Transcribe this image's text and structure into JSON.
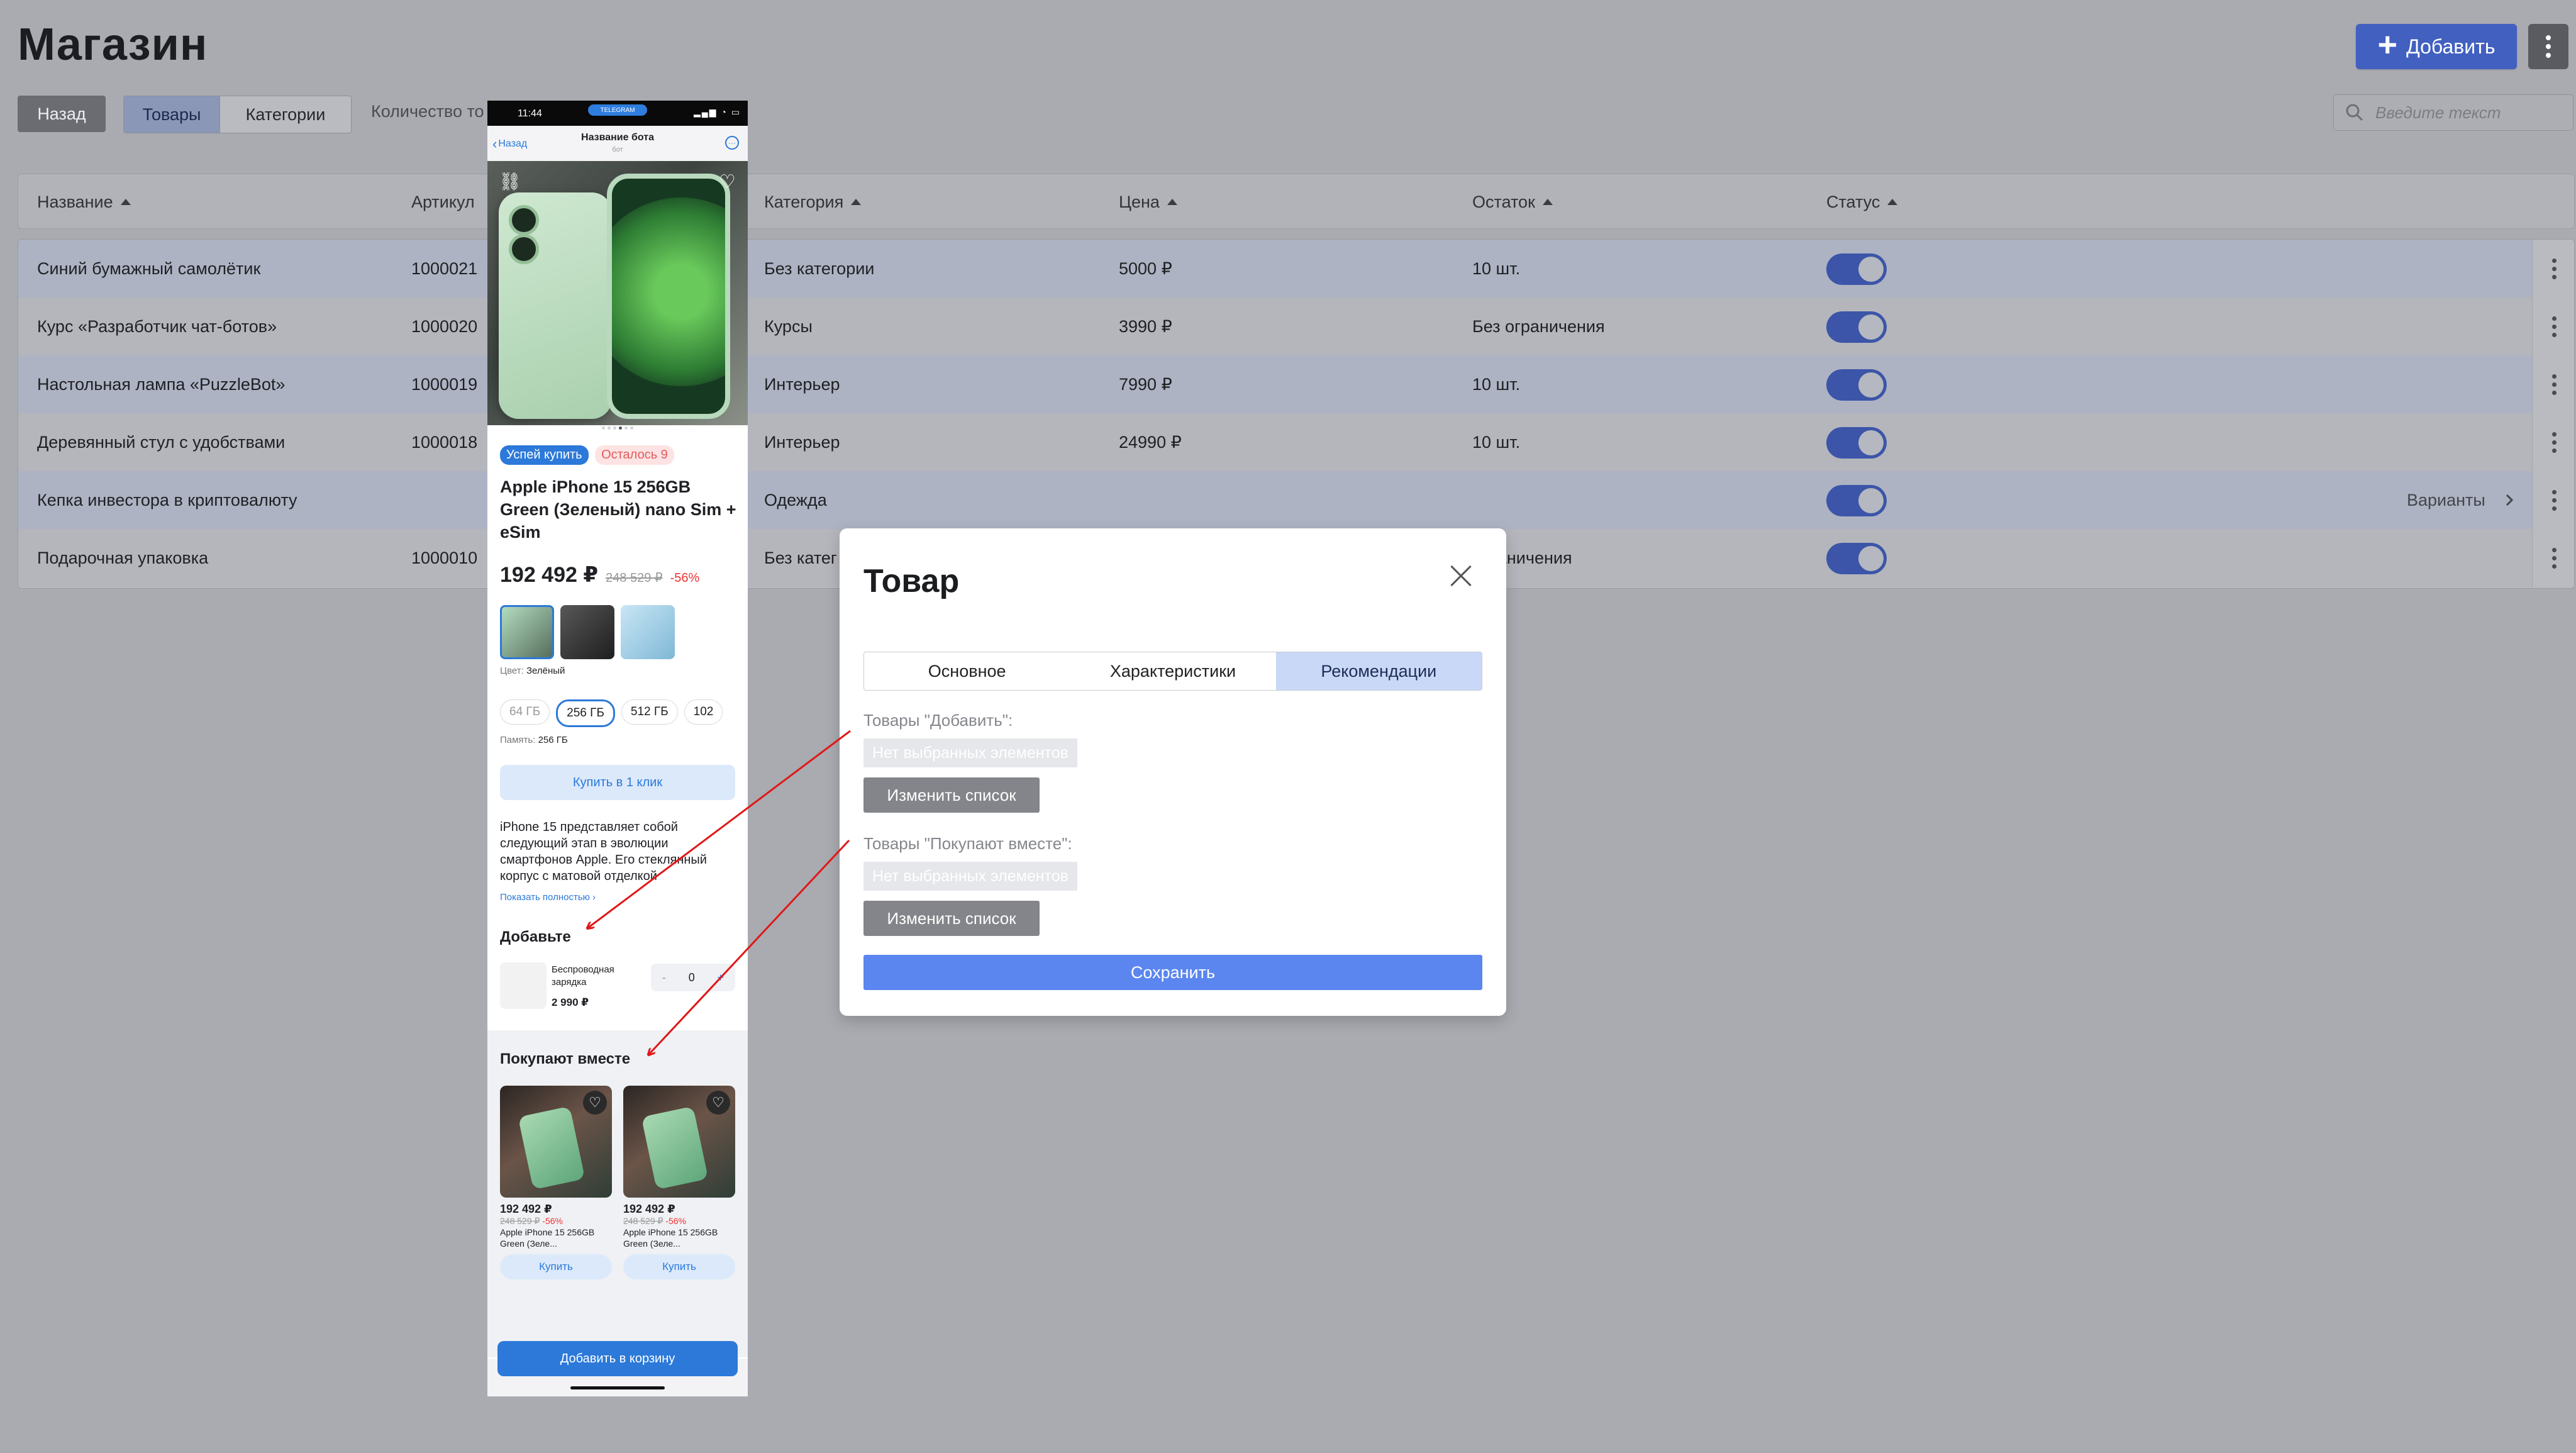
{
  "header": {
    "title": "Магазин",
    "add_label": "Добавить"
  },
  "toolbar": {
    "back_label": "Назад",
    "tabs": [
      "Товары",
      "Категории"
    ],
    "count_label": "Количество то",
    "search_placeholder": "Введите текст"
  },
  "table": {
    "columns": [
      "Название",
      "Артикул",
      "Категория",
      "Цена",
      "Остаток",
      "Статус"
    ],
    "rows": [
      {
        "name": "Синий бумажный самолётик",
        "sku": "1000021",
        "category": "Без категории",
        "price": "5000 ₽",
        "stock": "10 шт."
      },
      {
        "name": "Курс «Разработчик чат-ботов»",
        "sku": "1000020",
        "category": "Курсы",
        "price": "3990 ₽",
        "stock": "Без ограничения"
      },
      {
        "name": "Настольная лампа «PuzzleBot»",
        "sku": "1000019",
        "category": "Интерьер",
        "price": "7990 ₽",
        "stock": "10 шт."
      },
      {
        "name": "Деревянный стул с удобствами",
        "sku": "1000018",
        "category": "Интерьер",
        "price": "24990 ₽",
        "stock": "10 шт."
      },
      {
        "name": "Кепка инвестора в криптовалюту",
        "sku": "",
        "category": "Одежда",
        "price": "",
        "stock": "",
        "variants": "Варианты"
      },
      {
        "name": "Подарочная упаковка",
        "sku": "1000010",
        "category": "Без катег",
        "price": "",
        "stock": "ограничения"
      }
    ]
  },
  "phone": {
    "time": "11:44",
    "telegram": "TELEGRAM",
    "nav_back": "Назад",
    "bot_name": "Название бота",
    "bot_sub": "бот",
    "badge_hurry": "Успей купить",
    "badge_left": "Осталось 9",
    "product_title": "Apple iPhone 15 256GB Green (Зеленый) nano Sim + eSim",
    "price": "192 492 ₽",
    "old_price": "248 529 ₽",
    "discount": "-56%",
    "color_label": "Цвет:",
    "color_value": "Зелёный",
    "memory_options": [
      "64 ГБ",
      "256 ГБ",
      "512 ГБ",
      "102"
    ],
    "memory_label": "Память:",
    "memory_value": "256 ГБ",
    "buy_one_click": "Купить в 1 клик",
    "description": "iPhone 15 представляет собой следующий этап в эволюции смартфонов Apple. Его стеклянный корпус с матовой отделкой",
    "show_more": "Показать полностью",
    "addons_title": "Добавьте",
    "addon_name": "Беспроводная зарядка",
    "addon_price": "2 990 ₽",
    "addon_qty": "0",
    "together_title": "Покупают вместе",
    "cards": [
      {
        "price": "192 492 ₽",
        "old": "248 529 ₽",
        "disc": "-56%",
        "name": "Apple iPhone 15 256GB Green (Зеле...",
        "buy": "Купить"
      },
      {
        "price": "192 492 ₽",
        "old": "248 529 ₽",
        "disc": "-56%",
        "name": "Apple iPhone 15 256GB Green (Зеле...",
        "buy": "Купить"
      }
    ],
    "add_to_cart": "Добавить в корзину"
  },
  "modal": {
    "title": "Товар",
    "tabs": [
      "Основное",
      "Характеристики",
      "Рекомендации"
    ],
    "section1_label": "Товары \"Добавить\":",
    "section2_label": "Товары \"Покупают вместе\":",
    "empty_chip": "Нет выбранных элементов",
    "change_list": "Изменить список",
    "save": "Сохранить"
  },
  "colors": {
    "accent": "#4160c0",
    "toggle": "#3c55a8",
    "save": "#5b86f0",
    "arrow": "#e01818"
  }
}
